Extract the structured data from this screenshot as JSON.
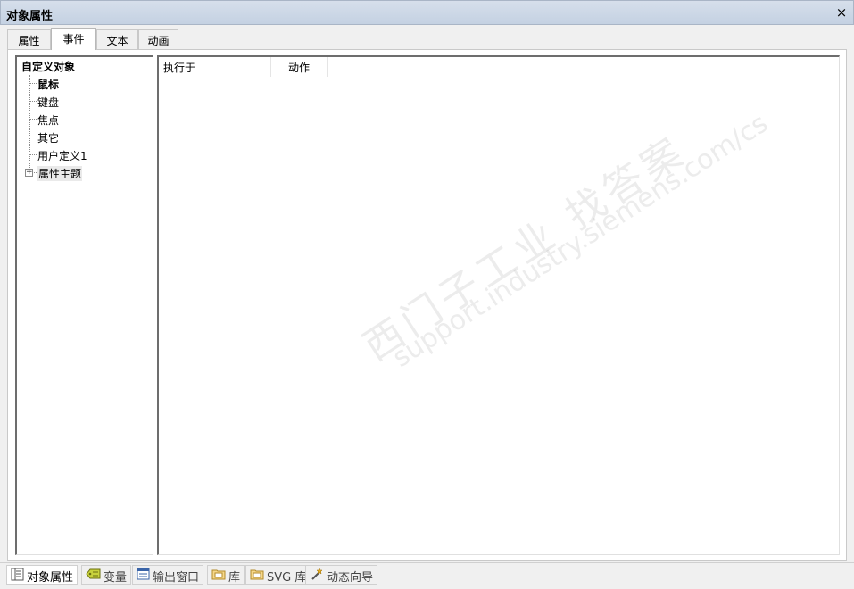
{
  "window": {
    "title": "对象属性",
    "close_label": "×"
  },
  "tabs": [
    {
      "label": "属性",
      "active": false
    },
    {
      "label": "事件",
      "active": true
    },
    {
      "label": "文本",
      "active": false
    },
    {
      "label": "动画",
      "active": false
    }
  ],
  "tree": {
    "root": "自定义对象",
    "items": [
      {
        "label": "鼠标",
        "bold": true
      },
      {
        "label": "键盘"
      },
      {
        "label": "焦点"
      },
      {
        "label": "其它"
      },
      {
        "label": "用户定义1"
      },
      {
        "label": "属性主题",
        "expandable": true,
        "selected": true
      }
    ]
  },
  "grid": {
    "columns": [
      "执行于",
      "动作"
    ]
  },
  "bottom_tabs": [
    {
      "label": "对象属性",
      "icon": "properties-icon",
      "active": true
    },
    {
      "label": "变量",
      "icon": "tag-icon"
    },
    {
      "label": "输出窗口",
      "icon": "output-window-icon"
    },
    {
      "label": "库",
      "icon": "library-folder-icon"
    },
    {
      "label": "SVG 库",
      "icon": "svg-library-folder-icon"
    },
    {
      "label": "动态向导",
      "icon": "wand-icon"
    }
  ],
  "watermark": {
    "line1": "西门子工业  找答案",
    "line2": "support.industry.siemens.com/cs"
  }
}
